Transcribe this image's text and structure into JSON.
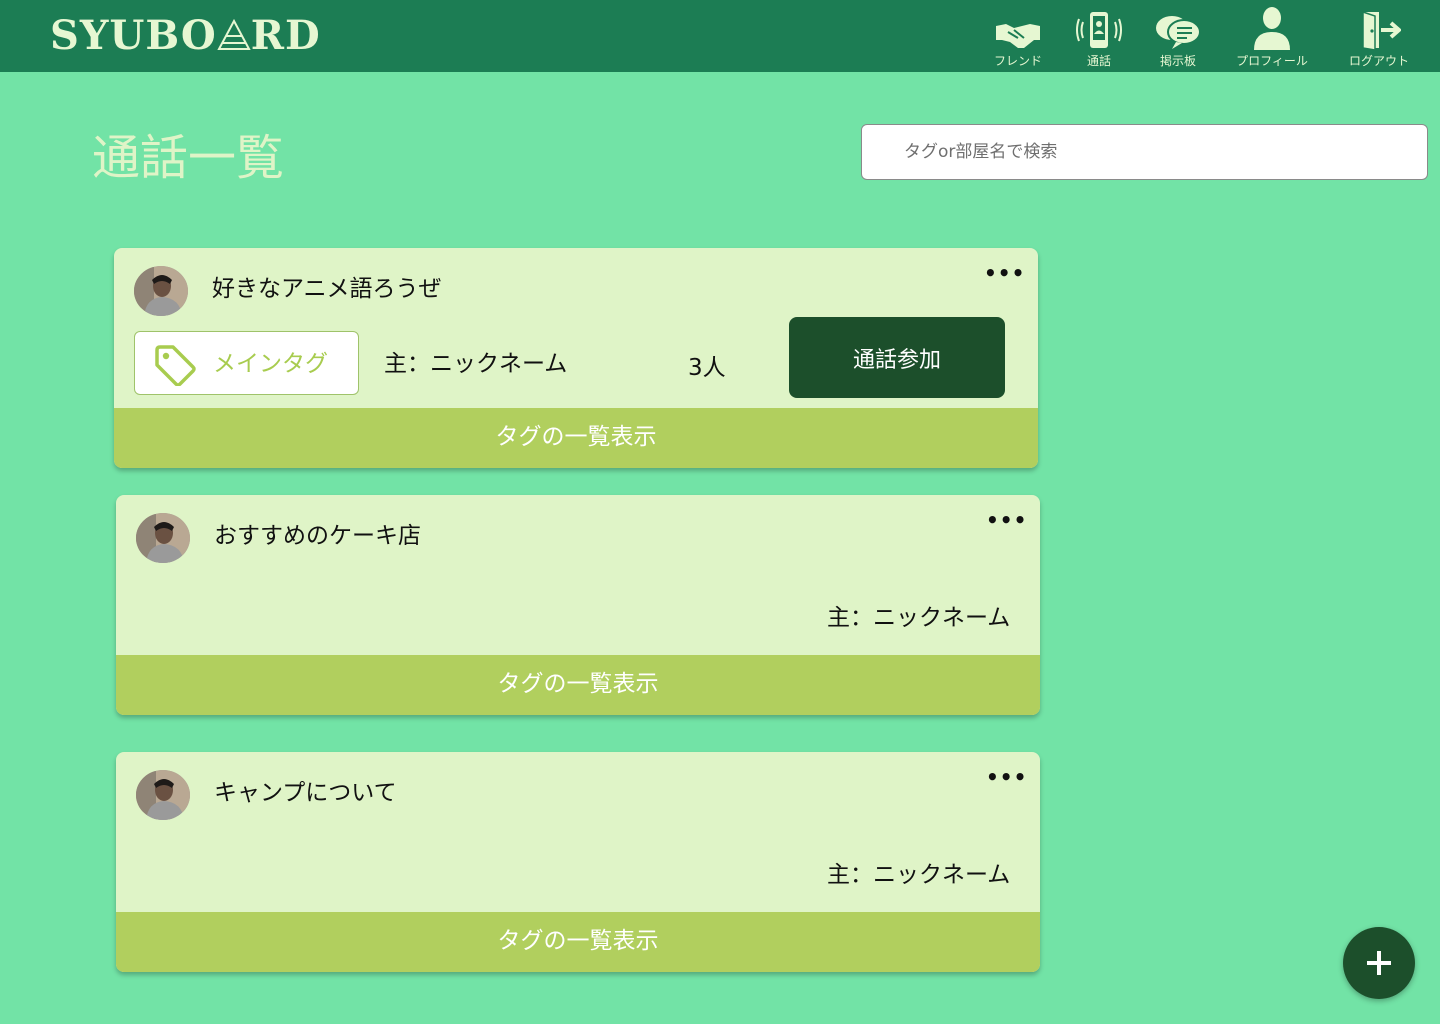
{
  "app": {
    "logo_text_left": "SYUBO",
    "logo_text_right": "RD"
  },
  "nav": {
    "friend": "フレンド",
    "call": "通話",
    "board": "掲示板",
    "profile": "プロフィール",
    "logout": "ログアウト"
  },
  "page": {
    "title": "通話一覧",
    "search_placeholder": "タグor部屋名で検索"
  },
  "rooms": [
    {
      "title": "好きなアニメ語ろうぜ",
      "tag": "メインタグ",
      "owner": "主：ニックネーム",
      "count": "3人",
      "join_label": "通話参加",
      "tags_label": "タグの一覧表示",
      "more": "•••"
    },
    {
      "title": "おすすめのケーキ店",
      "owner": "主：ニックネーム",
      "tags_label": "タグの一覧表示",
      "more": "•••"
    },
    {
      "title": "キャンプについて",
      "owner": "主：ニックネーム",
      "tags_label": "タグの一覧表示",
      "more": "•••"
    }
  ],
  "colors": {
    "header": "#1c7d54",
    "background": "#72e3a6",
    "card": "#dff4c7",
    "tags_bar": "#b1cf5e",
    "join_button": "#1c4f2b"
  },
  "icons": [
    "handshake-icon",
    "phone-call-icon",
    "chat-bubble-icon",
    "person-icon",
    "door-exit-icon",
    "tag-icon",
    "plus-icon"
  ]
}
